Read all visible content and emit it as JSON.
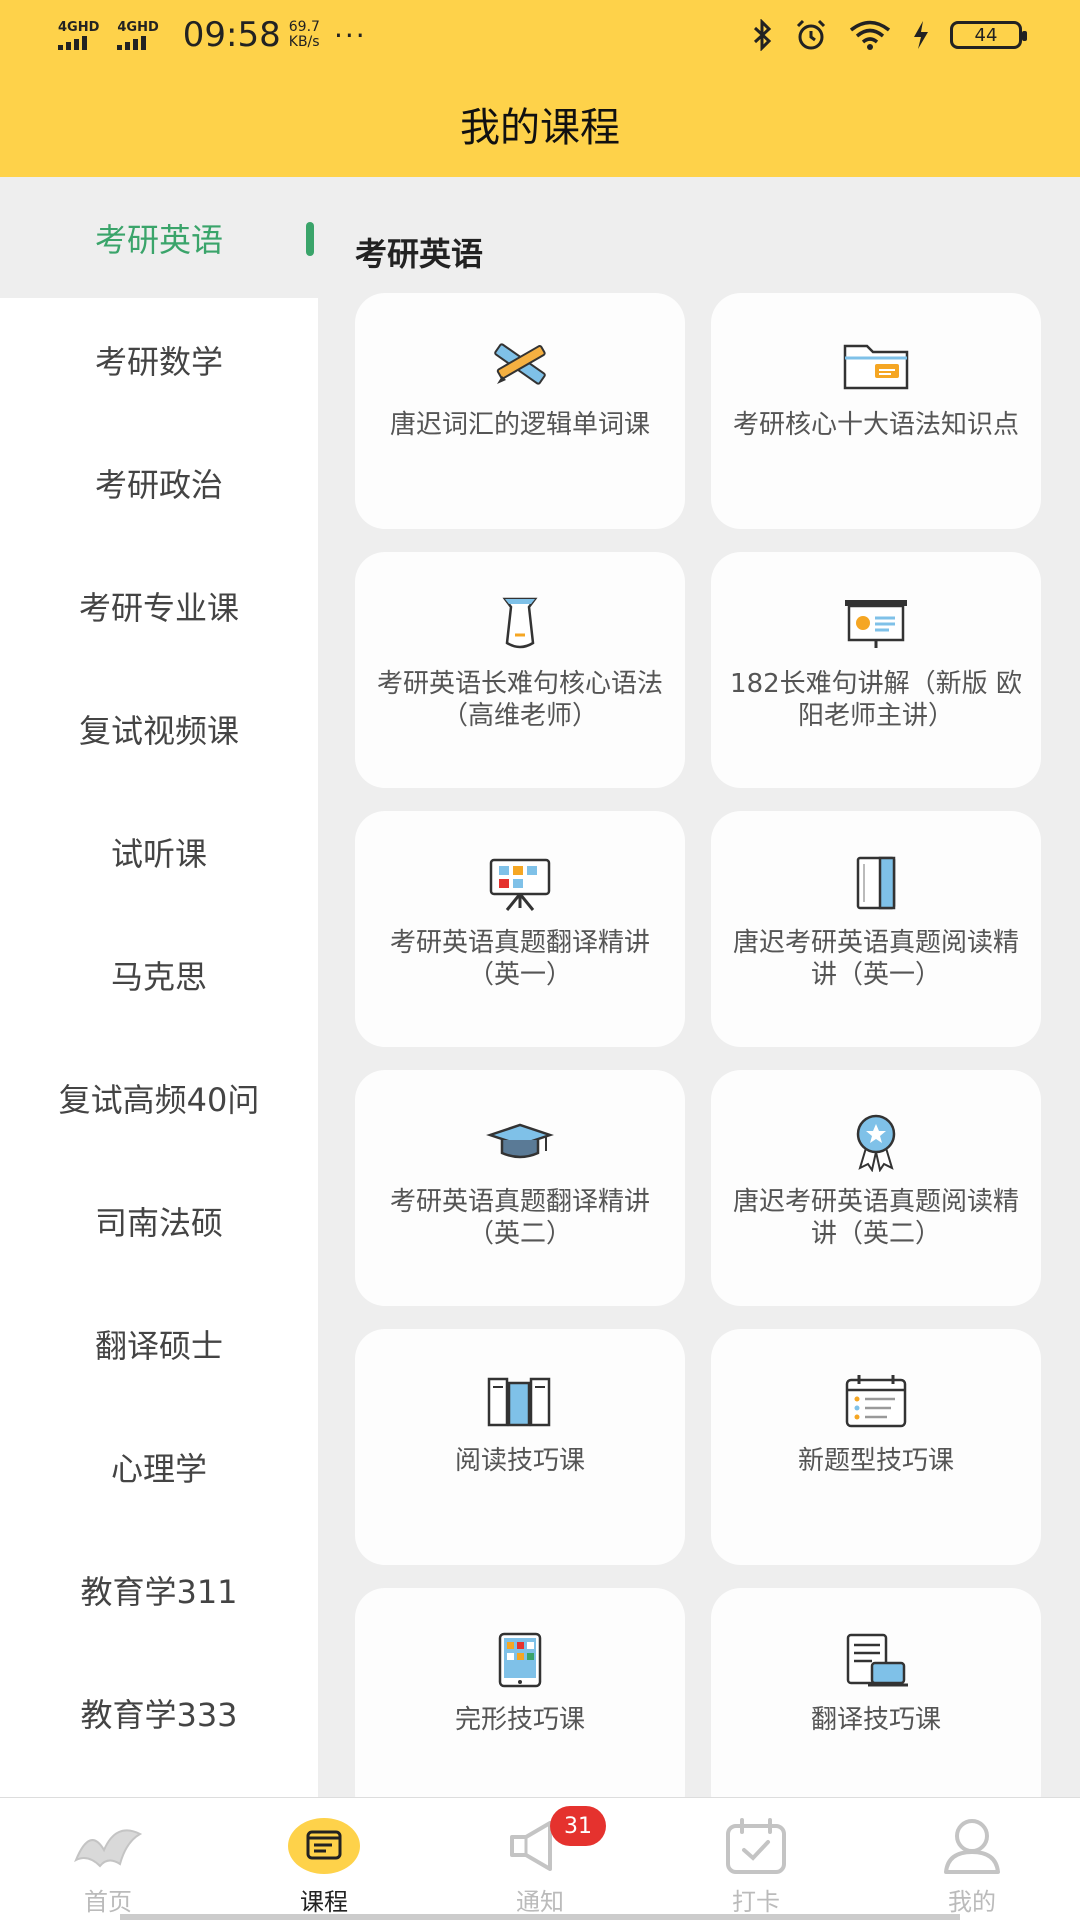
{
  "status_bar": {
    "network1": "4GHD",
    "network2": "4GHD",
    "time": "09:58",
    "speed_value": "69.7",
    "speed_unit": "KB/s",
    "more": "···",
    "battery": "44"
  },
  "header": {
    "title": "我的课程"
  },
  "sidebar": {
    "items": [
      {
        "label": "考研英语"
      },
      {
        "label": "考研数学"
      },
      {
        "label": "考研政治"
      },
      {
        "label": "考研专业课"
      },
      {
        "label": "复试视频课"
      },
      {
        "label": "试听课"
      },
      {
        "label": "马克思"
      },
      {
        "label": "复试高频40问"
      },
      {
        "label": "司南法硕"
      },
      {
        "label": "翻译硕士"
      },
      {
        "label": "心理学"
      },
      {
        "label": "教育学311"
      },
      {
        "label": "教育学333"
      }
    ],
    "active_color": "#3aa46a"
  },
  "main": {
    "section_title": "考研英语",
    "courses": [
      {
        "label": "唐迟词汇的逻辑单词课",
        "icon": "pencil-ruler-icon"
      },
      {
        "label": "考研核心十大语法知识点",
        "icon": "folder-icon"
      },
      {
        "label": "考研英语长难句核心语法（高维老师）",
        "icon": "flask-icon"
      },
      {
        "label": "182长难句讲解（新版 欧阳老师主讲）",
        "icon": "presentation-board-icon"
      },
      {
        "label": "考研英语真题翻译精讲（英一）",
        "icon": "easel-chart-icon"
      },
      {
        "label": "唐迟考研英语真题阅读精讲（英一）",
        "icon": "notebook-icon"
      },
      {
        "label": "考研英语真题翻译精讲（英二）",
        "icon": "graduation-cap-icon"
      },
      {
        "label": "唐迟考研英语真题阅读精讲（英二）",
        "icon": "award-medal-icon"
      },
      {
        "label": "阅读技巧课",
        "icon": "books-icon"
      },
      {
        "label": "新题型技巧课",
        "icon": "calendar-list-icon"
      },
      {
        "label": "完形技巧课",
        "icon": "tablet-apps-icon"
      },
      {
        "label": "翻译技巧课",
        "icon": "document-laptop-icon"
      }
    ]
  },
  "bottom_nav": {
    "items": [
      {
        "label": "首页",
        "icon": "home-logo-icon"
      },
      {
        "label": "课程",
        "icon": "course-icon"
      },
      {
        "label": "通知",
        "icon": "megaphone-icon",
        "badge": "31"
      },
      {
        "label": "打卡",
        "icon": "checkin-calendar-icon"
      },
      {
        "label": "我的",
        "icon": "user-icon"
      }
    ],
    "badge_color": "#e5322e"
  },
  "colors": {
    "header": "#fed24a",
    "accent_green": "#3aa46a"
  }
}
